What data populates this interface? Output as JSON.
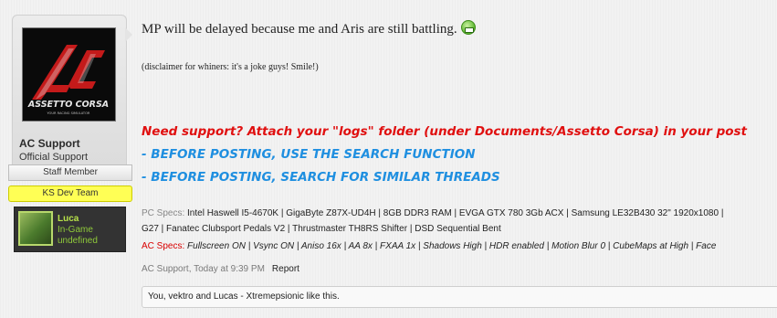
{
  "user": {
    "name": "AC Support",
    "title": "Official Support",
    "banner_staff": "Staff Member",
    "banner_team": "KS Dev Team",
    "ingame": {
      "name": "Luca",
      "status": "In-Game",
      "sub": "undefined"
    },
    "avatar_logo": {
      "main": "ASSETTO CORSA",
      "tagline": "YOUR RACING SIMULATOR"
    }
  },
  "message": {
    "main": "MP will be delayed because me and Aris are still battling.",
    "disclaimer": "(disclaimer for whiners: it's a joke guys! Smile!)"
  },
  "signature": {
    "line_red": "Need support? Attach your \"logs\" folder (under Documents/Assetto Corsa) in your post",
    "line_blue1": "- BEFORE POSTING, USE THE SEARCH FUNCTION",
    "line_blue2": "- BEFORE POSTING, SEARCH FOR SIMILAR THREADS",
    "pc_label": "PC Specs:",
    "pc_specs_1": "Intel Haswell I5-4670K | GigaByte Z87X-UD4H | 8GB DDR3 RAM | EVGA GTX 780 3Gb ACX | Samsung LE32B430 32\" 1920x1080 |",
    "pc_specs_2": "G27 | Fanatec Clubsport Pedals V2 | Thrustmaster TH8RS Shifter | DSD Sequential Bent",
    "ac_label": "AC Specs:",
    "ac_specs": "Fullscreen ON | Vsync ON | Aniso 16x | AA 8x | FXAA 1x | Shadows High | HDR enabled | Motion Blur 0 | CubeMaps at High | Face"
  },
  "meta": {
    "author_time": "AC Support, Today at 9:39 PM",
    "report": "Report"
  },
  "likes": {
    "text": "You, vektro and Lucas - Xtremepsionic like this."
  },
  "colors": {
    "signature_red": "#e01010",
    "signature_blue": "#1f8fe0",
    "ks_banner": "#ffff55",
    "ingame_green": "#8fc93a"
  }
}
